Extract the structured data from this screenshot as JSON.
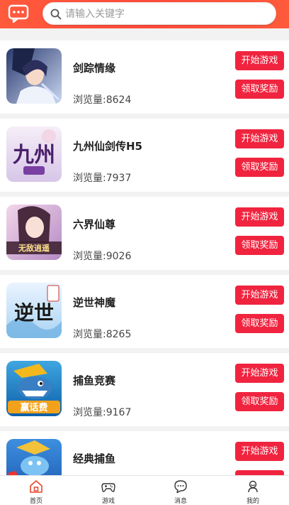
{
  "search": {
    "placeholder": "请输入关键字"
  },
  "games": [
    {
      "name": "剑踪情缘",
      "views": "浏览量:8624",
      "start_label": "开始游戏",
      "reward_label": "领取奖励"
    },
    {
      "name": "九州仙剑传H5",
      "views": "浏览量:7937",
      "start_label": "开始游戏",
      "reward_label": "领取奖励"
    },
    {
      "name": "六界仙尊",
      "views": "浏览量:9026",
      "start_label": "开始游戏",
      "reward_label": "领取奖励"
    },
    {
      "name": "逆世神魔",
      "views": "浏览量:8265",
      "start_label": "开始游戏",
      "reward_label": "领取奖励"
    },
    {
      "name": "捕鱼竞赛",
      "views": "浏览量:9167",
      "start_label": "开始游戏",
      "reward_label": "领取奖励"
    },
    {
      "name": "经典捕鱼",
      "start_label": "开始游戏"
    }
  ],
  "thumb_text": {
    "jiuzhou": "九州",
    "liujie": "无敌逍遥",
    "nishi": "逆世",
    "buyu": "赢话费"
  },
  "tabbar": {
    "items": [
      {
        "label": "首页",
        "icon": "home-icon"
      },
      {
        "label": "游戏",
        "icon": "gamepad-icon"
      },
      {
        "label": "消息",
        "icon": "message-icon"
      },
      {
        "label": "我的",
        "icon": "user-icon"
      }
    ]
  },
  "colors": {
    "header": "#ff4b3a",
    "button": "#f0243f",
    "active_tab": "#e8462e"
  }
}
